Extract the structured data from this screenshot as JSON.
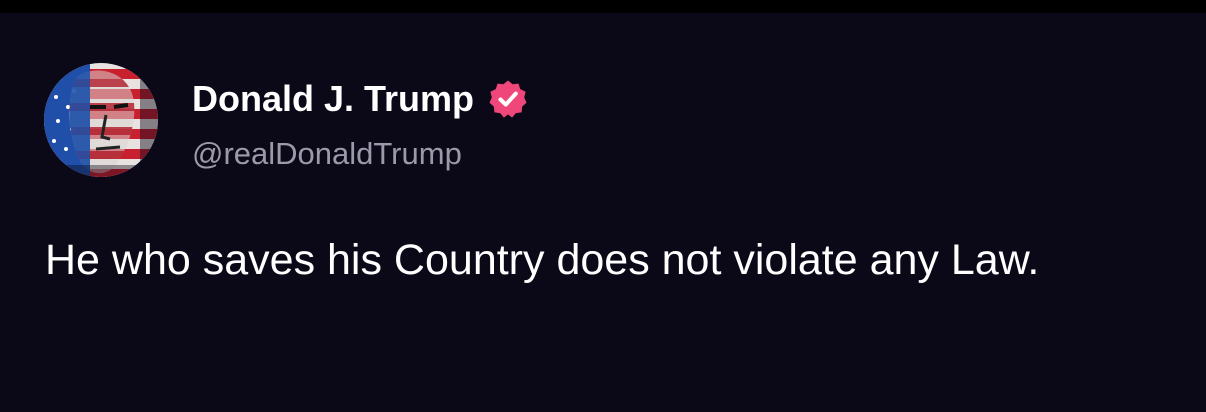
{
  "post": {
    "author": {
      "display_name": "Donald J. Trump",
      "handle": "@realDonaldTrump",
      "verified": true,
      "verified_color": "#f0477a",
      "avatar_icon": "flag-portrait-avatar"
    },
    "text": "He who saves his Country does not violate any Law."
  },
  "colors": {
    "background": "#0b0818",
    "text": "#ffffff",
    "handle": "#9c99ab"
  }
}
